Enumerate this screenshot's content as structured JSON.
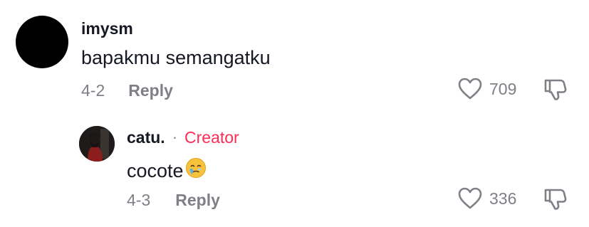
{
  "comment": {
    "username": "imysm",
    "text": "bapakmu semangatku",
    "date": "4-2",
    "reply_label": "Reply",
    "likes": "709"
  },
  "reply": {
    "username": "catu.",
    "separator": "·",
    "badge": "Creator",
    "text": "cocote",
    "emoji_icon": "face-holding-back-tears-icon",
    "date": "4-3",
    "reply_label": "Reply",
    "likes": "336"
  },
  "icons": {
    "like": "heart-outline-icon",
    "dislike": "thumbs-down-outline-icon"
  },
  "colors": {
    "text_primary": "#161823",
    "text_secondary": "#7f8087",
    "creator_badge": "#fe2c55"
  }
}
